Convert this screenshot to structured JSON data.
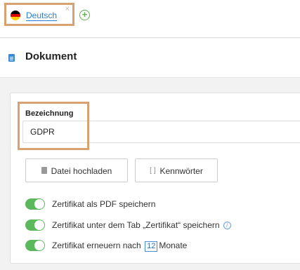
{
  "tabs": {
    "items": [
      {
        "label": "Deutsch",
        "flag_colors": [
          "#000000",
          "#dd0000",
          "#ffce00"
        ],
        "close_glyph": "×"
      }
    ],
    "add_glyph": "+"
  },
  "header": {
    "title": "Dokument",
    "icon": "document-icon"
  },
  "form": {
    "name_label": "Bezeichnung",
    "name_value": "GDPR",
    "upload_button": "Datei hochladen",
    "keywords_button": "Kennwörter",
    "keywords_icon_glyph": "[ ]"
  },
  "toggles": [
    {
      "text": "Zertifikat als PDF speichern",
      "on": true
    },
    {
      "text": "Zertifikat unter dem Tab „Zertifikat“ speichern",
      "on": true,
      "info_glyph": "i"
    },
    {
      "text_before": "Zertifikat erneuern nach",
      "months_value": "12",
      "text_after": "Monate",
      "on": true
    }
  ],
  "colors": {
    "accent": "#2a7dd1",
    "toggle_on": "#5cb85c",
    "highlight": "#d9a070"
  }
}
